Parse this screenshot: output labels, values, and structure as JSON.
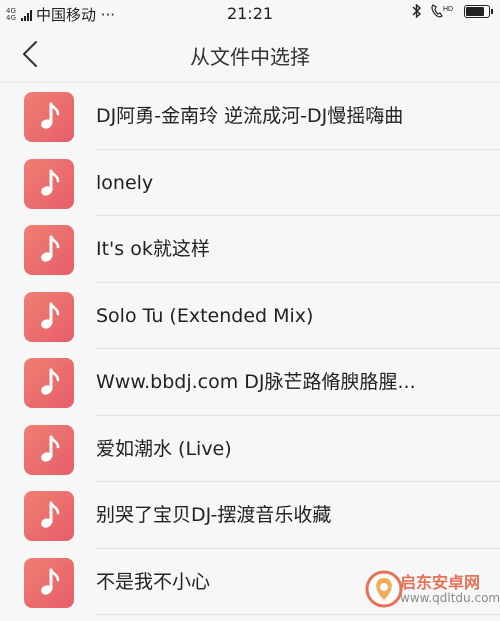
{
  "status_bar": {
    "network_type": "4G 4G",
    "carrier": "中国移动 ···",
    "time": "21:21",
    "icons": [
      "bluetooth-icon",
      "hd-call-icon",
      "battery-icon"
    ],
    "hd_label": "HD",
    "battery_level": 0.75
  },
  "header": {
    "title": "从文件中选择",
    "back_icon": "chevron-left-icon"
  },
  "files": [
    {
      "name": "DJ阿勇-金南玲 逆流成河-DJ慢摇嗨曲",
      "icon": "music-note-icon"
    },
    {
      "name": "lonely",
      "icon": "music-note-icon"
    },
    {
      "name": "It's ok就这样",
      "icon": "music-note-icon"
    },
    {
      "name": "Solo Tu (Extended Mix)",
      "icon": "music-note-icon"
    },
    {
      "name": "Www.bbdj.com DJ脉芒路脩腴胳腥...",
      "icon": "music-note-icon"
    },
    {
      "name": "爱如潮水 (Live)",
      "icon": "music-note-icon"
    },
    {
      "name": "别哭了宝贝DJ-摆渡音乐收藏",
      "icon": "music-note-icon"
    },
    {
      "name": "不是我不小心",
      "icon": "music-note-icon"
    }
  ],
  "watermark": {
    "name": "启东安卓网",
    "url": "www.qdltdu.com"
  },
  "colors": {
    "accent": "#ea6a6d",
    "background": "#f7f7f7",
    "watermark": "#e35a3a"
  }
}
